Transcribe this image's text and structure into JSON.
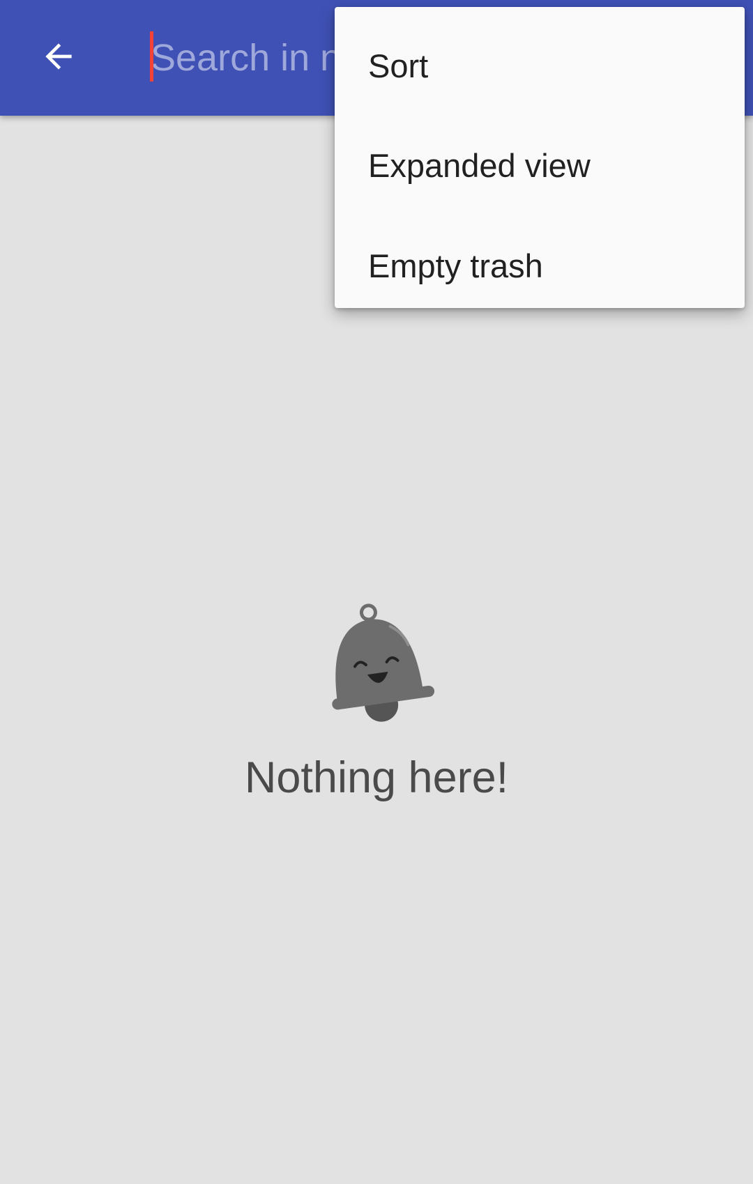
{
  "toolbar": {
    "back_icon": "arrow-left-icon",
    "search": {
      "placeholder": "Search in notes",
      "value": ""
    },
    "bg_color": "#3f51b5"
  },
  "overflow_menu": {
    "items": [
      {
        "label": "Sort"
      },
      {
        "label": "Expanded view"
      },
      {
        "label": "Empty trash"
      }
    ]
  },
  "empty_state": {
    "icon": "smiling-bell-icon",
    "message": "Nothing here!"
  }
}
